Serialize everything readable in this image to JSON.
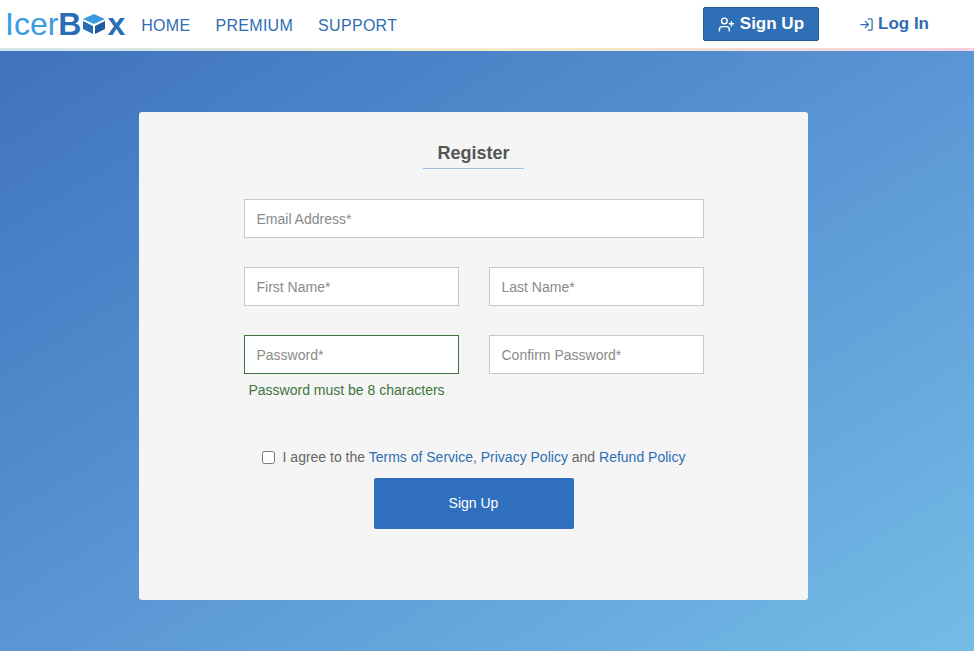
{
  "header": {
    "logo": {
      "light": "Icer",
      "bold_before": "B",
      "bold_after": "x"
    },
    "nav": [
      "HOME",
      "PREMIUM",
      "SUPPORT"
    ],
    "signup_button": "Sign Up",
    "login_link": "Log In"
  },
  "form": {
    "title": "Register",
    "fields": [
      {
        "placeholder": "Email Address*",
        "focused": false
      },
      {
        "placeholder": "First Name*",
        "focused": false
      },
      {
        "placeholder": "Last Name*",
        "focused": false
      },
      {
        "placeholder": "Password*",
        "focused": true
      },
      {
        "placeholder": "Confirm Password*",
        "focused": false
      }
    ],
    "password_hint": "Password must be 8 characters",
    "agreement": {
      "checked": false,
      "prefix": "I agree to the",
      "links": [
        "Terms of Service",
        "Privacy Policy",
        "Refund Policy"
      ],
      "separators": [
        ",",
        "and"
      ]
    },
    "submit": "Sign Up"
  }
}
